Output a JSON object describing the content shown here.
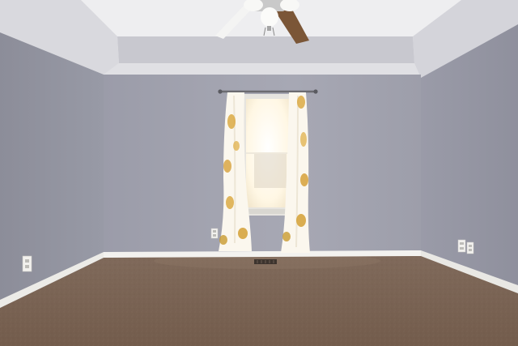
{
  "scene": {
    "subject": "Empty bedroom",
    "colors": {
      "wall_back": "#9ea0ad",
      "wall_left": "#8f909c",
      "wall_right": "#9596a3",
      "ceiling": "#e8e8ea",
      "tray_soffit": "#c9c9d0",
      "baseboard": "#f2f1ee",
      "carpet": "#7b6454",
      "curtain": "#fbf7ee",
      "curtain_pattern": "#d9a53a",
      "window_light": "#fffaf0",
      "fan_blade": "#7b5637",
      "fan_metal": "#c9c9c9"
    },
    "objects": [
      "ceiling-fan",
      "window",
      "curtain-left",
      "curtain-right",
      "curtain-rod",
      "floor-vent",
      "outlet-left-wall",
      "outlet-back-wall",
      "outlet-right-wall"
    ]
  }
}
